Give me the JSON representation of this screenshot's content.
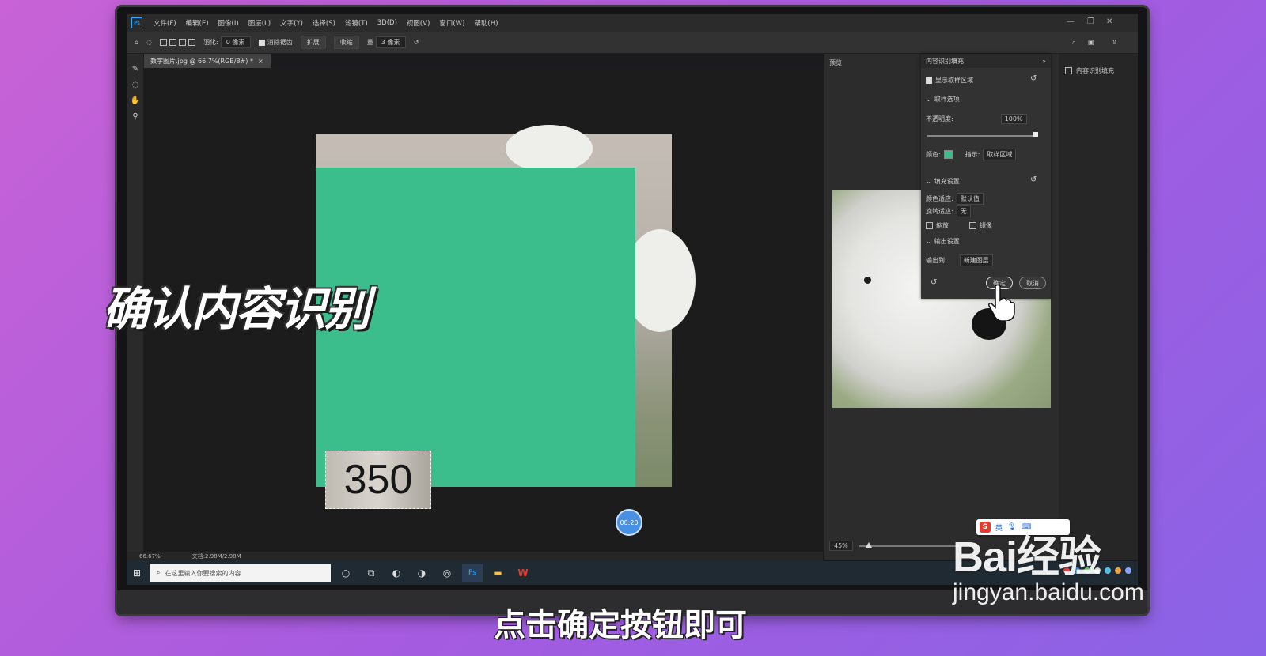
{
  "menubar": {
    "app_icon": "Ps",
    "items": [
      "文件(F)",
      "编辑(E)",
      "图像(I)",
      "图层(L)",
      "文字(Y)",
      "选择(S)",
      "滤镜(T)",
      "3D(D)",
      "视图(V)",
      "窗口(W)",
      "帮助(H)"
    ]
  },
  "options_bar": {
    "feather_label": "羽化:",
    "feather_value": "0 像素",
    "antialias_label": "消除锯齿",
    "expand_label": "扩展",
    "contract_label": "收缩",
    "amount_label": "量",
    "amount_value": "3 像素"
  },
  "document": {
    "tab_title": "数字图片.jpg @ 66.7%(RGB/8#) *",
    "close_glyph": "×",
    "overlay_number": "350",
    "zoom_status": "66.67%",
    "doc_status": "文档:2.98M/2.98M"
  },
  "preview_panel": {
    "title": "预览",
    "zoom": "45%"
  },
  "properties_panel": {
    "title": "内容识别填充",
    "show_sampling_area": "显示取样区域",
    "sampling_options": "取样选项",
    "opacity_label": "不透明度:",
    "opacity_value": "100%",
    "color_label": "颜色:",
    "indicate_label": "指示:",
    "indicate_value": "取样区域",
    "fill_settings": "填充设置",
    "color_adapt_label": "颜色适应:",
    "color_adapt_value": "默认值",
    "rotate_adapt_label": "旋转适应:",
    "rotate_adapt_value": "无",
    "scale_label": "缩放",
    "mirror_label": "镜像",
    "output_settings": "输出设置",
    "output_to_label": "输出到:",
    "output_to_value": "新建图层",
    "ok_label": "确定",
    "cancel_label": "取消"
  },
  "dock": {
    "item_label": "内容识别填充"
  },
  "taskbar": {
    "search_placeholder": "在这里输入你要搜索的内容",
    "ime_lang": "英"
  },
  "overlays": {
    "timer": "00:20",
    "big_caption": "确认内容识别",
    "subtitle": "点击确定按钮即可",
    "watermark_brand": "Bai经验",
    "watermark_cn": "经验",
    "watermark_url": "jingyan.baidu.com"
  },
  "colors": {
    "fill_green": "#3bbd8c",
    "accent_blue": "#31a8ff"
  }
}
